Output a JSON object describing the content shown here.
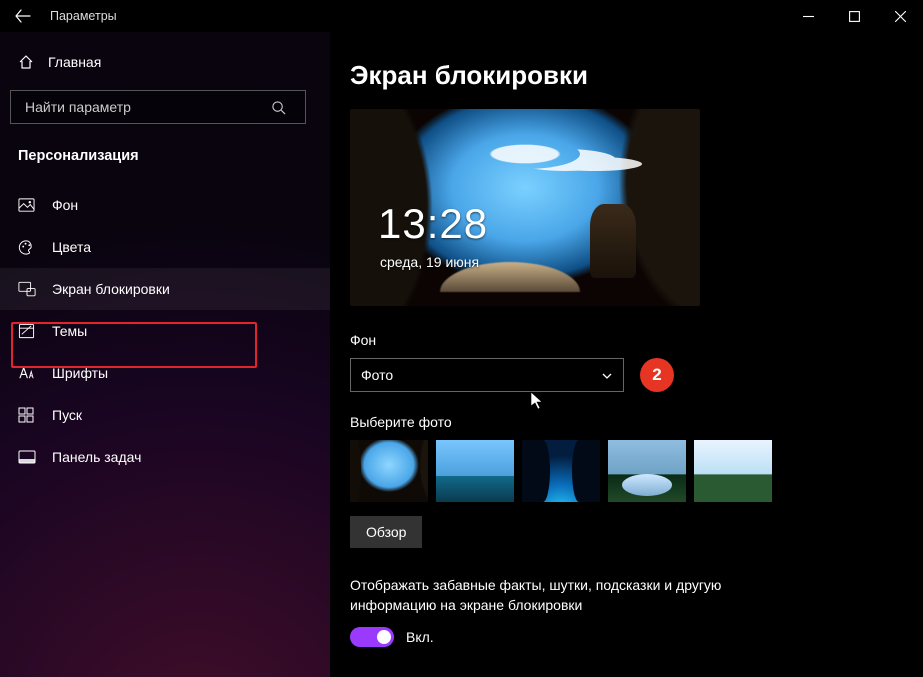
{
  "window": {
    "title": "Параметры"
  },
  "sidebar": {
    "home": "Главная",
    "search_placeholder": "Найти параметр",
    "category": "Персонализация",
    "items": [
      {
        "label": "Фон"
      },
      {
        "label": "Цвета"
      },
      {
        "label": "Экран блокировки",
        "selected": true
      },
      {
        "label": "Темы"
      },
      {
        "label": "Шрифты"
      },
      {
        "label": "Пуск"
      },
      {
        "label": "Панель задач"
      }
    ]
  },
  "main": {
    "heading": "Экран блокировки",
    "preview": {
      "time": "13:28",
      "date": "среда, 19 июня"
    },
    "background_label": "Фон",
    "background_value": "Фото",
    "callout_number": "2",
    "choose_photo_label": "Выберите фото",
    "browse": "Обзор",
    "fun_facts_label": "Отображать забавные факты, шутки, подсказки и другую информацию на экране блокировки",
    "toggle_state": "Вкл."
  }
}
